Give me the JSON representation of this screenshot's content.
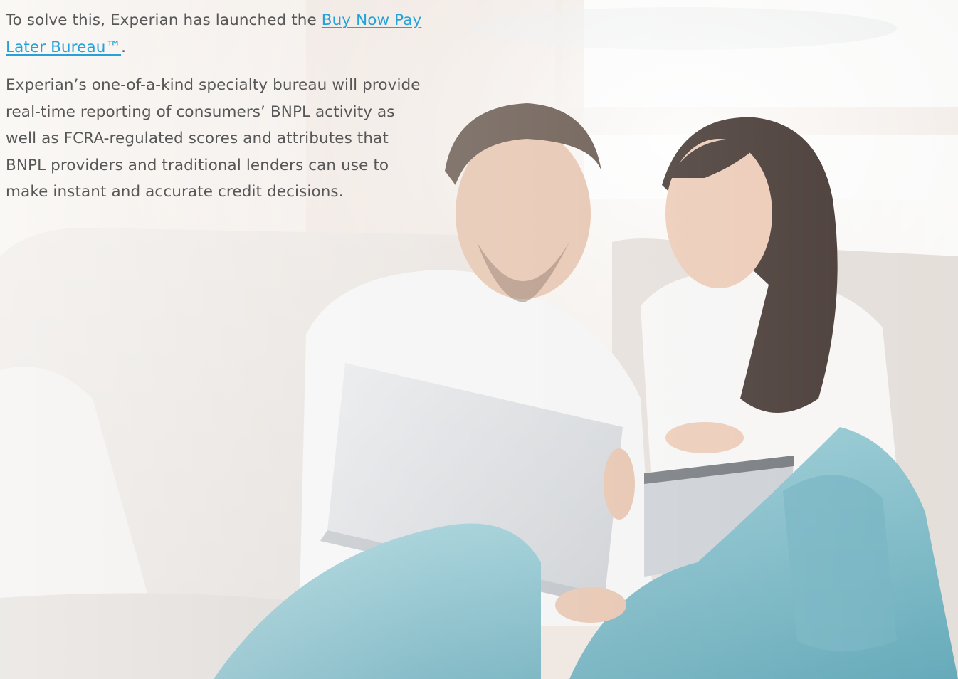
{
  "article": {
    "p1_prefix": "To solve this, Experian has launched the ",
    "p1_link_text": "Buy Now Pay Later Bureau™",
    "p1_suffix": ".",
    "p2": "Experian’s one-of-a-kind specialty bureau will provide real-time reporting of consumers’ BNPL activity as well as FCRA-regulated scores and attributes that BNPL providers and traditional lenders can use to make instant and accurate credit decisions."
  },
  "colors": {
    "text": "#575757",
    "link": "#26a2d8",
    "background": "#ffffff"
  }
}
